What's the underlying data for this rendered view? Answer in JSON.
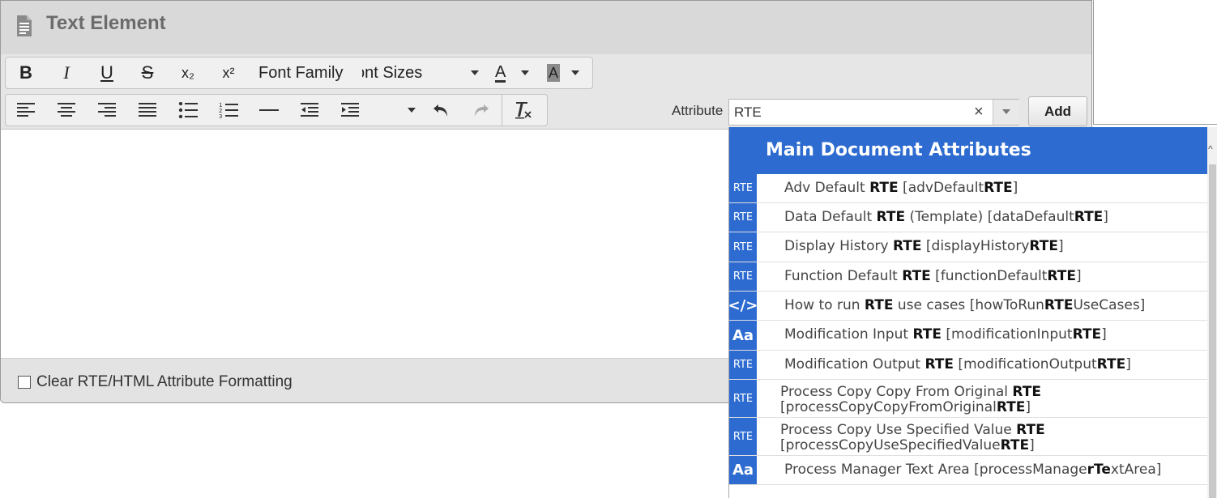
{
  "window": {
    "title": "Text Element"
  },
  "toolbar1": {
    "bold": "B",
    "italic": "I",
    "underline": "U",
    "strike": "S",
    "subscript": "x₂",
    "superscript": "x²",
    "font_family": "Font Family",
    "font_sizes": "ont Sizes",
    "text_color": "A",
    "bg_color": "A"
  },
  "attribute": {
    "label": "Attribute",
    "value": "RTE",
    "clear": "×",
    "add_label": "Add"
  },
  "footer": {
    "checkbox_label": "Clear RTE/HTML Attribute Formatting",
    "checked": false
  },
  "dropdown": {
    "header": "Main Document Attributes",
    "items": [
      {
        "badge": "RTE",
        "pre": "Adv Default ",
        "bold": "RTE",
        "mid": " [advDefault",
        "bold2": "RTE",
        "post": "]"
      },
      {
        "badge": "RTE",
        "pre": "Data Default ",
        "bold": "RTE",
        "mid": " (Template) [dataDefault",
        "bold2": "RTE",
        "post": "]"
      },
      {
        "badge": "RTE",
        "pre": "Display History ",
        "bold": "RTE",
        "mid": " [displayHistory",
        "bold2": "RTE",
        "post": "]"
      },
      {
        "badge": "RTE",
        "pre": "Function Default ",
        "bold": "RTE",
        "mid": " [functionDefault",
        "bold2": "RTE",
        "post": "]"
      },
      {
        "badge": "</>",
        "pre": "How to run ",
        "bold": "RTE",
        "mid": " use cases [howToRun",
        "bold2": "RTE",
        "post": "UseCases]"
      },
      {
        "badge": "Aa",
        "pre": "Modification Input ",
        "bold": "RTE",
        "mid": " [modificationInput",
        "bold2": "RTE",
        "post": "]"
      },
      {
        "badge": "RTE",
        "pre": "Modification Output ",
        "bold": "RTE",
        "mid": " [modificationOutput",
        "bold2": "RTE",
        "post": "]"
      },
      {
        "badge": "RTE",
        "pre": "Process Copy Copy From Original ",
        "bold": "RTE",
        "mid": " [processCopyCopyFromOriginal",
        "bold2": "RTE",
        "post": "]"
      },
      {
        "badge": "RTE",
        "pre": "Process Copy Use Specified Value ",
        "bold": "RTE",
        "mid": " [processCopyUseSpecifiedValue",
        "bold2": "RTE",
        "post": "]"
      },
      {
        "badge": "Aa",
        "pre": "Process Manager Text Area [processManage",
        "bold": "rTe",
        "mid": "xtArea]",
        "bold2": "",
        "post": ""
      }
    ]
  },
  "colors": {
    "accent": "#2d6bd1",
    "titlebar": "#d9d9d9",
    "toolbar": "#e6e6e6"
  }
}
